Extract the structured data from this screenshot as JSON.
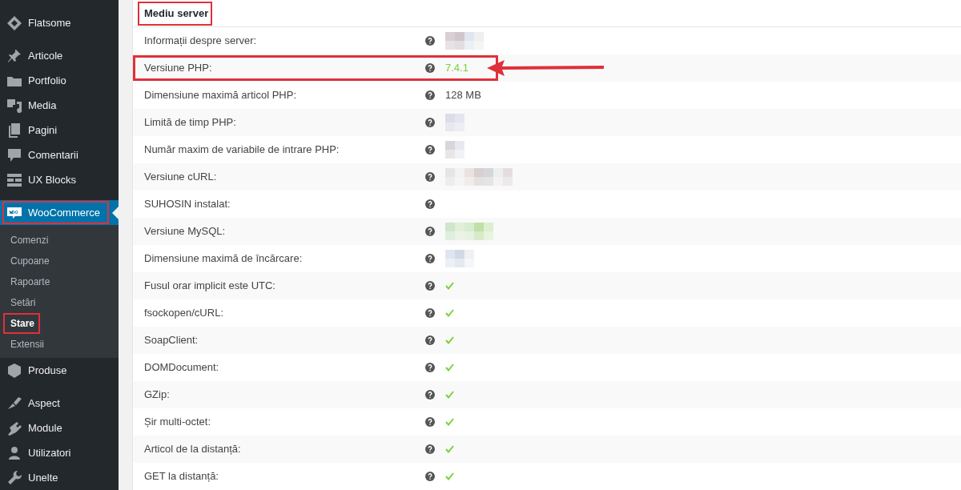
{
  "sidebar": {
    "groups": [
      [
        {
          "label": "Flatsome",
          "highlighted": false
        }
      ],
      [
        {
          "label": "Articole",
          "highlighted": false
        },
        {
          "label": "Portfolio",
          "highlighted": false
        },
        {
          "label": "Media",
          "highlighted": false
        },
        {
          "label": "Pagini",
          "highlighted": false
        },
        {
          "label": "Comentarii",
          "highlighted": false
        },
        {
          "label": "UX Blocks",
          "highlighted": false
        }
      ],
      [
        {
          "label": "WooCommerce",
          "highlighted": true,
          "expanded": true,
          "submenu": [
            {
              "label": "Comenzi",
              "selected": false,
              "highlighted": false
            },
            {
              "label": "Cupoane",
              "selected": false,
              "highlighted": false
            },
            {
              "label": "Rapoarte",
              "selected": false,
              "highlighted": false
            },
            {
              "label": "Setări",
              "selected": false,
              "highlighted": false
            },
            {
              "label": "Stare",
              "selected": true,
              "highlighted": true
            },
            {
              "label": "Extensii",
              "selected": false,
              "highlighted": false
            }
          ]
        },
        {
          "label": "Produse",
          "highlighted": false
        }
      ],
      [
        {
          "label": "Aspect",
          "highlighted": false
        },
        {
          "label": "Module",
          "highlighted": false
        },
        {
          "label": "Utilizatori",
          "highlighted": false
        },
        {
          "label": "Unelte",
          "highlighted": false
        }
      ]
    ]
  },
  "section": {
    "title": "Mediu server",
    "highlighted": true,
    "rows": [
      {
        "label": "Informații despre server:",
        "kind": "redacted",
        "highlighted": false,
        "arrow": false
      },
      {
        "label": "Versiune PHP:",
        "kind": "version",
        "value": "7.4.1",
        "highlighted": true,
        "arrow": true
      },
      {
        "label": "Dimensiune maximă articol PHP:",
        "kind": "text",
        "value": "128 MB",
        "highlighted": false,
        "arrow": false
      },
      {
        "label": "Limită de timp PHP:",
        "kind": "redacted",
        "highlighted": false,
        "arrow": false
      },
      {
        "label": "Număr maxim de variabile de intrare PHP:",
        "kind": "redacted",
        "highlighted": false,
        "arrow": false
      },
      {
        "label": "Versiune cURL:",
        "kind": "redacted",
        "highlighted": false,
        "arrow": false
      },
      {
        "label": "SUHOSIN instalat:",
        "kind": "none",
        "highlighted": false,
        "arrow": false
      },
      {
        "label": "Versiune MySQL:",
        "kind": "redacted",
        "highlighted": false,
        "arrow": false
      },
      {
        "label": "Dimensiune maximă de încărcare:",
        "kind": "redacted",
        "highlighted": false,
        "arrow": false
      },
      {
        "label": "Fusul orar implicit este UTC:",
        "kind": "check",
        "highlighted": false,
        "arrow": false
      },
      {
        "label": "fsockopen/cURL:",
        "kind": "check",
        "highlighted": false,
        "arrow": false
      },
      {
        "label": "SoapClient:",
        "kind": "check",
        "highlighted": false,
        "arrow": false
      },
      {
        "label": "DOMDocument:",
        "kind": "check",
        "highlighted": false,
        "arrow": false
      },
      {
        "label": "GZip:",
        "kind": "check",
        "highlighted": false,
        "arrow": false
      },
      {
        "label": "Șir multi-octet:",
        "kind": "check",
        "highlighted": false,
        "arrow": false
      },
      {
        "label": "Articol de la distanță:",
        "kind": "check",
        "highlighted": false,
        "arrow": false
      },
      {
        "label": "GET la distanță:",
        "kind": "check",
        "highlighted": false,
        "arrow": false
      }
    ]
  }
}
